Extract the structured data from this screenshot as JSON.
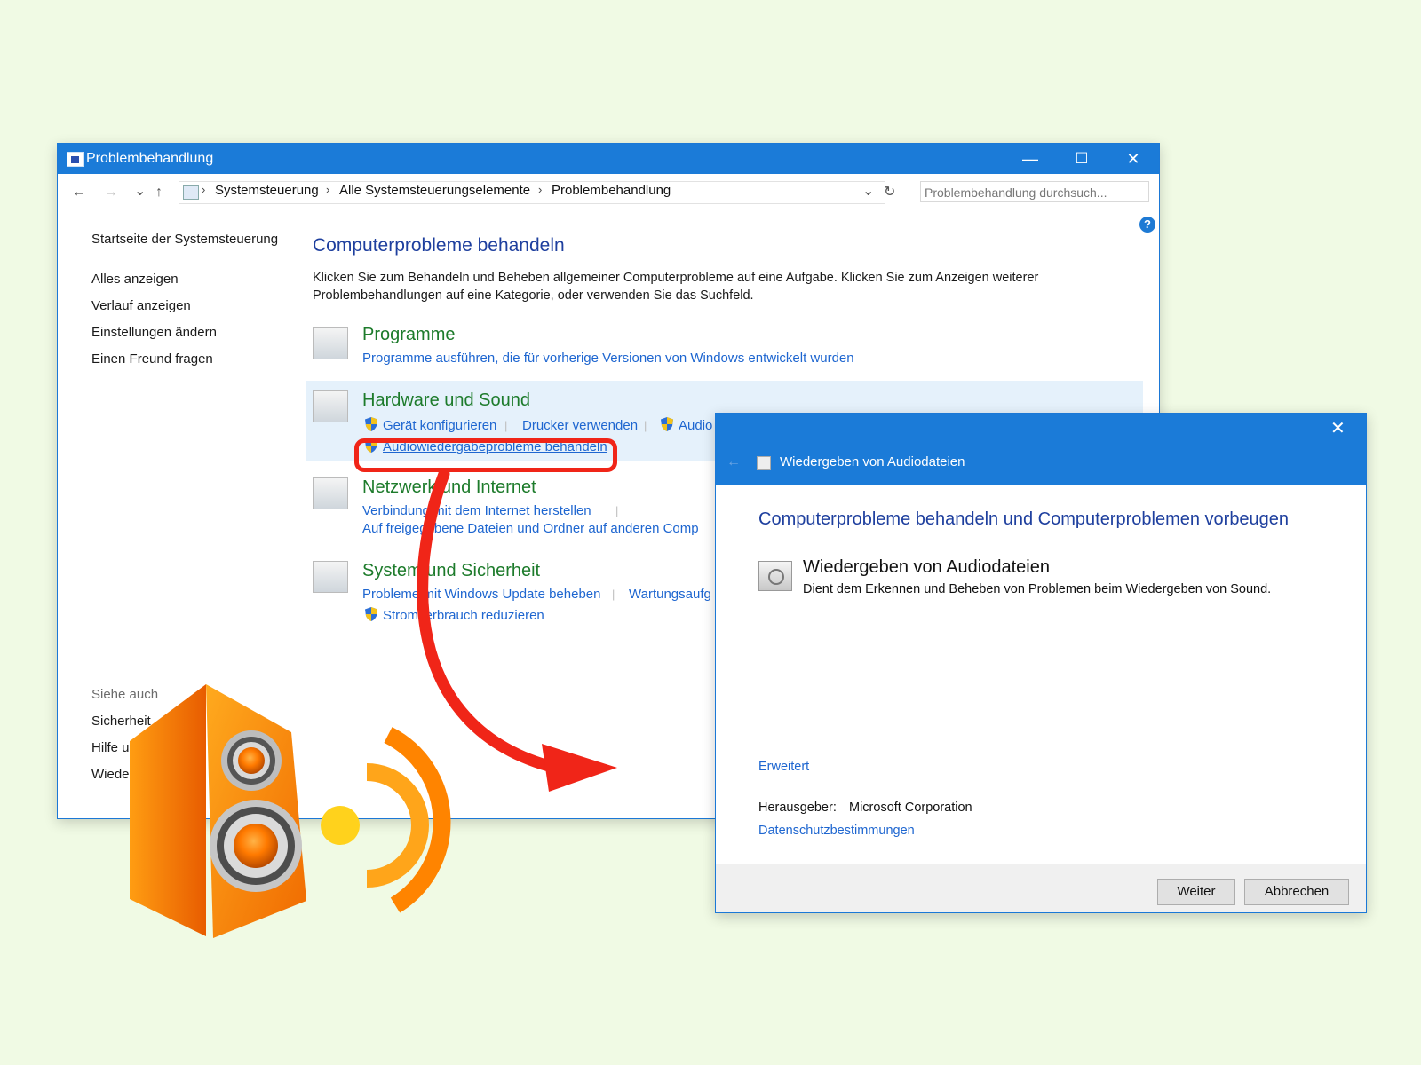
{
  "window": {
    "title": "Problembehandlung",
    "minimize_glyph": "—",
    "maximize_glyph": "☐",
    "close_glyph": "✕"
  },
  "address": {
    "back_glyph": "←",
    "forward_glyph": "→",
    "recent_glyph": "⌄",
    "up_glyph": "↑",
    "crumbs": [
      "Systemsteuerung",
      "Alle Systemsteuerungselemente",
      "Problembehandlung"
    ],
    "separator": "›",
    "dropdown_glyph": "⌄",
    "refresh_glyph": "↻",
    "search_placeholder": "Problembehandlung durchsuch..."
  },
  "help_glyph": "?",
  "sidebar": {
    "home": "Startseite der Systemsteuerung",
    "items": [
      "Alles anzeigen",
      "Verlauf anzeigen",
      "Einstellungen ändern",
      "Einen Freund fragen"
    ],
    "see_also": "Siehe auch",
    "see_also_items": [
      "Sicherheit",
      "Hilfe u",
      "Wiede"
    ]
  },
  "main": {
    "heading": "Computerprobleme behandeln",
    "intro_line1": "Klicken Sie zum Behandeln und Beheben allgemeiner Computerprobleme auf eine Aufgabe. Klicken Sie zum Anzeigen weiterer",
    "intro_line2": "Problembehandlungen auf eine Kategorie, oder verwenden Sie das Suchfeld.",
    "categories": {
      "programs": {
        "title": "Programme",
        "link1": "Programme ausführen, die für vorherige Versionen von Windows entwickelt wurden"
      },
      "hardware": {
        "title": "Hardware und Sound",
        "link1": "Gerät konfigurieren",
        "link2": "Drucker verwenden",
        "link3": "Audio",
        "link4": "Audiowiedergabeprobleme behandeln"
      },
      "network": {
        "title": "Netzwerk und Internet",
        "link1": "Verbindung mit dem Internet herstellen",
        "link2": "Auf freigegebene Dateien und Ordner auf anderen Comp"
      },
      "system": {
        "title": "System und Sicherheit",
        "link1": "Probleme mit Windows Update beheben",
        "link2": "Wartungsaufg",
        "link3": "Stromverbrauch reduzieren"
      }
    },
    "divider": "|"
  },
  "dialog": {
    "close_glyph": "✕",
    "back_glyph": "←",
    "title": "Wiedergeben von Audiodateien",
    "heading": "Computerprobleme behandeln und Computerproblemen vorbeugen",
    "item_name": "Wiedergeben von Audiodateien",
    "item_desc": "Dient dem Erkennen und Beheben von Problemen beim Wiedergeben von Sound.",
    "advanced": "Erweitert",
    "publisher_label": "Herausgeber:",
    "publisher_value": "Microsoft Corporation",
    "privacy": "Datenschutzbestimmungen",
    "next_button": "Weiter",
    "cancel_button": "Abbrechen"
  },
  "colors": {
    "titlebar": "#1b7bd8",
    "background": "#f0fae4",
    "highlight_red": "#f02518",
    "link_blue": "#1e66d0",
    "category_green": "#1d7b2b",
    "speaker_orange": "#ff8a00"
  },
  "icons": [
    "shield-icon",
    "speaker-icon",
    "sound-waves-icon",
    "arrow-icon"
  ]
}
